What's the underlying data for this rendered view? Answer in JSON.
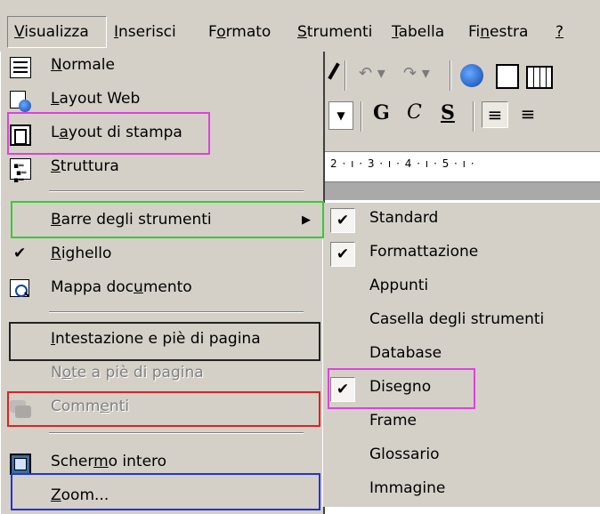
{
  "menubar": {
    "items": [
      {
        "label": "Visualizza",
        "key": "V"
      },
      {
        "label": "Inserisci",
        "key": "I"
      },
      {
        "label": "Formato",
        "key": "o"
      },
      {
        "label": "Strumenti",
        "key": "S"
      },
      {
        "label": "Tabella",
        "key": "T"
      },
      {
        "label": "Finestra",
        "key": "n"
      },
      {
        "label": "?",
        "key": "?"
      }
    ]
  },
  "toolbar": {
    "bold": "G",
    "italic": "C",
    "underline": "S",
    "ruler_text": "2 · ı · 3 · ı · 4 · ı · 5 · ı ·"
  },
  "menu": {
    "items": [
      {
        "label": "Normale",
        "icon": "normal-view-icon"
      },
      {
        "label": "Layout Web",
        "icon": "web-layout-icon"
      },
      {
        "label": "Layout di stampa",
        "icon": "print-layout-icon"
      },
      {
        "label": "Struttura",
        "icon": "outline-icon"
      },
      {
        "label": "Barre degli strumenti",
        "submenu": true
      },
      {
        "label": "Righello",
        "checked": true
      },
      {
        "label": "Mappa documento",
        "icon": "document-map-icon"
      },
      {
        "label": "Intestazione e piè di pagina"
      },
      {
        "label": "Note a piè di pagina",
        "disabled": true
      },
      {
        "label": "Commenti",
        "icon": "comments-icon",
        "disabled": true
      },
      {
        "label": "Schermo intero",
        "icon": "full-screen-icon"
      },
      {
        "label": "Zoom..."
      }
    ]
  },
  "submenu": {
    "items": [
      {
        "label": "Standard",
        "checked": true
      },
      {
        "label": "Formattazione",
        "checked": true
      },
      {
        "label": "Appunti",
        "checked": false
      },
      {
        "label": "Casella degli strumenti",
        "checked": false
      },
      {
        "label": "Database",
        "checked": false
      },
      {
        "label": "Disegno",
        "checked": true
      },
      {
        "label": "Frame",
        "checked": false
      },
      {
        "label": "Glossario",
        "checked": false
      },
      {
        "label": "Immagine",
        "checked": false
      }
    ],
    "check_glyph": "✔"
  },
  "colors": {
    "face": "#d4d0c8",
    "highlight_magenta": "#e040e0",
    "highlight_green": "#33cc33",
    "highlight_black": "#222222",
    "highlight_red": "#e02020",
    "highlight_blue": "#2233dd"
  }
}
